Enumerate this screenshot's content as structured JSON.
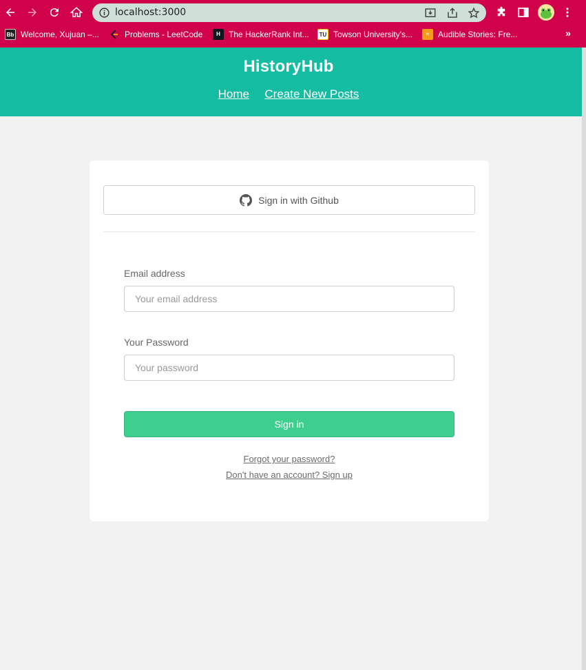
{
  "browser": {
    "url": "localhost:3000",
    "bookmarks": [
      {
        "label": "Welcome, Xujuan –...",
        "icon": "blackboard-icon"
      },
      {
        "label": "Problems - LeetCode",
        "icon": "leetcode-icon"
      },
      {
        "label": "The HackerRank Int...",
        "icon": "hackerrank-icon"
      },
      {
        "label": "Towson University's...",
        "icon": "towson-icon"
      },
      {
        "label": "Audible Stories: Fre...",
        "icon": "audible-icon"
      }
    ],
    "more_bookmarks": "»",
    "colors": {
      "frame": "#d0024a",
      "omnibox": "#cfe0d8"
    }
  },
  "site": {
    "brand": "HistoryHub",
    "nav": {
      "home": "Home",
      "create": "Create New Posts"
    },
    "colors": {
      "header": "#14bca2",
      "primary_button": "#3ecf8e"
    }
  },
  "auth": {
    "github_label": "Sign in with Github",
    "email_label": "Email address",
    "email_placeholder": "Your email address",
    "password_label": "Your Password",
    "password_placeholder": "Your password",
    "submit_label": "Sign in",
    "forgot_link": "Forgot your password?",
    "signup_link": "Don't have an account? Sign up"
  }
}
